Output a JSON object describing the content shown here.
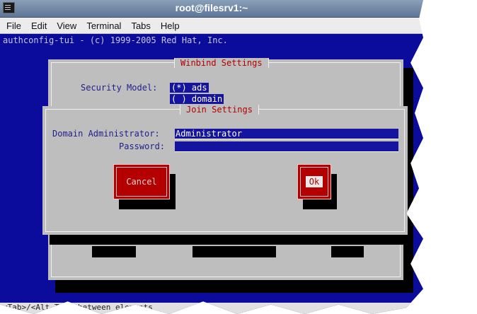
{
  "window": {
    "title": "root@filesrv1:~",
    "menu": [
      "File",
      "Edit",
      "View",
      "Terminal",
      "Tabs",
      "Help"
    ]
  },
  "terminal": {
    "header_line": "authconfig-tui - (c) 1999-2005 Red Hat, Inc.",
    "status_line": "<Tab>/<Alt-Tab> between elements"
  },
  "winbind": {
    "title": "Winbind Settings",
    "security_model_label": "Security Model:",
    "options": [
      "(*) ads",
      "( ) domain"
    ]
  },
  "join": {
    "title": "Join Settings",
    "domain_admin_label": "Domain Administrator:",
    "domain_admin_value": "Administrator",
    "password_label": "Password:",
    "password_value": "",
    "cancel_label": "Cancel",
    "ok_label": "Ok"
  },
  "colors": {
    "terminal_bg": "#0c0c9c",
    "dialog_bg": "#bebebe",
    "accent_red": "#b40000",
    "text_blue": "#1e1e8c"
  }
}
